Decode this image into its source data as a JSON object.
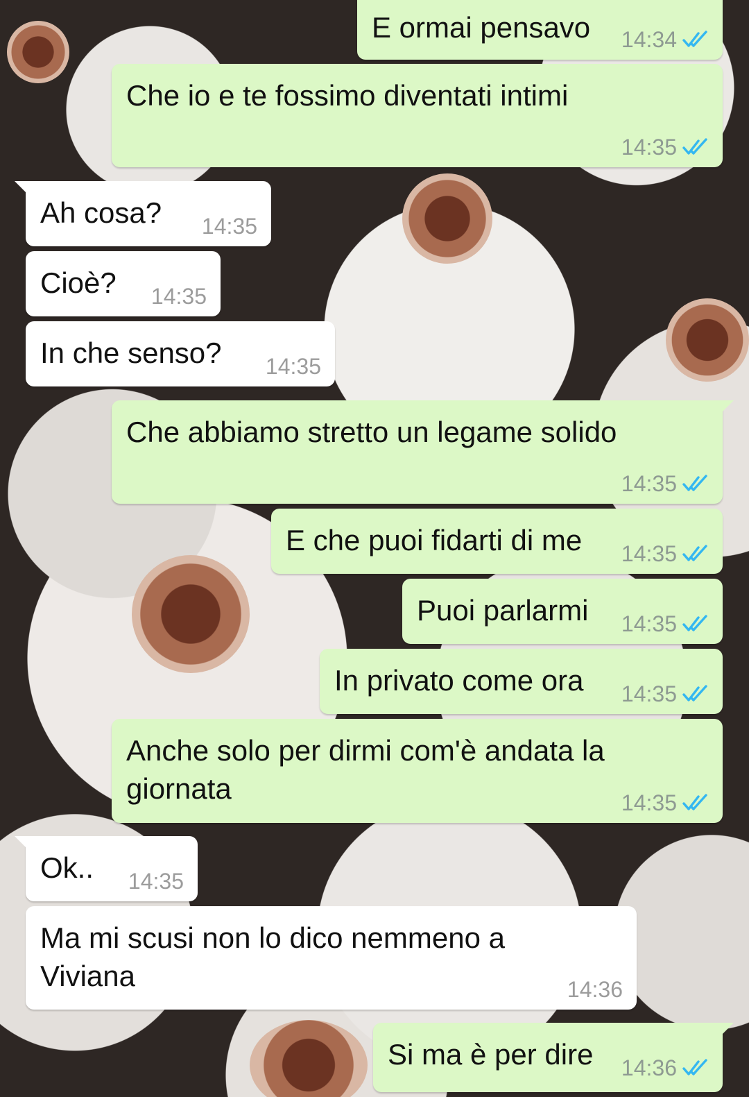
{
  "messages": [
    {
      "dir": "out",
      "text": "E ormai pensavo",
      "time": "14:34",
      "status": "read"
    },
    {
      "dir": "out",
      "text": "Che io e te fossimo diventati intimi",
      "time": "14:35",
      "status": "read"
    },
    {
      "dir": "in",
      "text": "Ah cosa?",
      "time": "14:35"
    },
    {
      "dir": "in",
      "text": "Cioè?",
      "time": "14:35"
    },
    {
      "dir": "in",
      "text": "In che senso?",
      "time": "14:35"
    },
    {
      "dir": "out",
      "text": "Che abbiamo stretto un legame solido",
      "time": "14:35",
      "status": "read"
    },
    {
      "dir": "out",
      "text": "E che puoi fidarti di me",
      "time": "14:35",
      "status": "read"
    },
    {
      "dir": "out",
      "text": "Puoi parlarmi",
      "time": "14:35",
      "status": "read"
    },
    {
      "dir": "out",
      "text": "In privato come ora",
      "time": "14:35",
      "status": "read"
    },
    {
      "dir": "out",
      "text": "Anche solo per dirmi com'è andata la\ngiornata",
      "time": "14:35",
      "status": "read"
    },
    {
      "dir": "in",
      "text": "Ok..",
      "time": "14:35"
    },
    {
      "dir": "in",
      "text": "Ma mi scusi non lo dico nemmeno a\nViviana",
      "time": "14:36"
    },
    {
      "dir": "out",
      "text": "Si ma è per dire",
      "time": "14:36",
      "status": "read"
    }
  ],
  "colors": {
    "outgoing_bubble": "#dcf8c6",
    "incoming_bubble": "#ffffff",
    "read_ticks": "#34b7f1"
  },
  "icons": {
    "read_status": "double-check-icon"
  }
}
